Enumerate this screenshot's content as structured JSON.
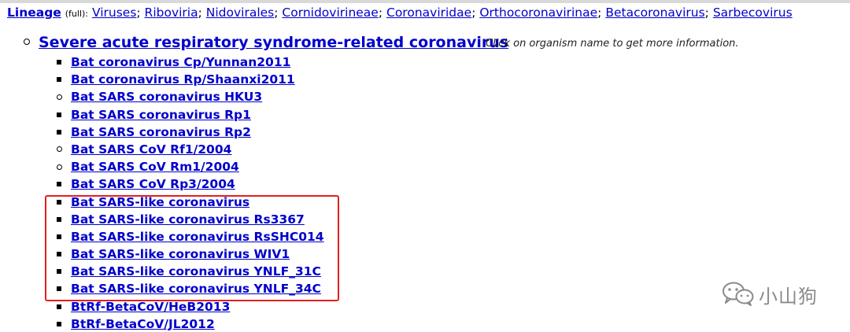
{
  "lineage": {
    "label": "Lineage",
    "qualifier": "(full):",
    "items": [
      "Viruses",
      "Riboviria",
      "Nidovirales",
      "Cornidovirineae",
      "Coronaviridae",
      "Orthocoronavirinae",
      "Betacoronavirus",
      "Sarbecovirus"
    ]
  },
  "species": {
    "name": "Severe acute respiratory syndrome-related coronavirus",
    "hint": "Click on organism name to get more information."
  },
  "strains": [
    {
      "name": "Bat coronavirus Cp/Yunnan2011",
      "marker": "square"
    },
    {
      "name": "Bat coronavirus Rp/Shaanxi2011",
      "marker": "square"
    },
    {
      "name": "Bat SARS coronavirus HKU3",
      "marker": "circle"
    },
    {
      "name": "Bat SARS coronavirus Rp1",
      "marker": "square"
    },
    {
      "name": "Bat SARS coronavirus Rp2",
      "marker": "square"
    },
    {
      "name": "Bat SARS CoV Rf1/2004",
      "marker": "circle"
    },
    {
      "name": "Bat SARS CoV Rm1/2004",
      "marker": "circle"
    },
    {
      "name": "Bat SARS CoV Rp3/2004",
      "marker": "square"
    },
    {
      "name": "Bat SARS-like coronavirus",
      "marker": "square"
    },
    {
      "name": "Bat SARS-like coronavirus Rs3367",
      "marker": "square"
    },
    {
      "name": "Bat SARS-like coronavirus RsSHC014",
      "marker": "square"
    },
    {
      "name": "Bat SARS-like coronavirus WIV1",
      "marker": "square"
    },
    {
      "name": "Bat SARS-like coronavirus YNLF_31C",
      "marker": "square"
    },
    {
      "name": "Bat SARS-like coronavirus YNLF_34C",
      "marker": "square"
    },
    {
      "name": "BtRf-BetaCoV/HeB2013",
      "marker": "square"
    },
    {
      "name": "BtRf-BetaCoV/JL2012",
      "marker": "square"
    }
  ],
  "watermark": {
    "text": "小山狗",
    "icon": "wechat-icon"
  },
  "colors": {
    "link": "#0000cc",
    "highlight": "#e02020"
  }
}
